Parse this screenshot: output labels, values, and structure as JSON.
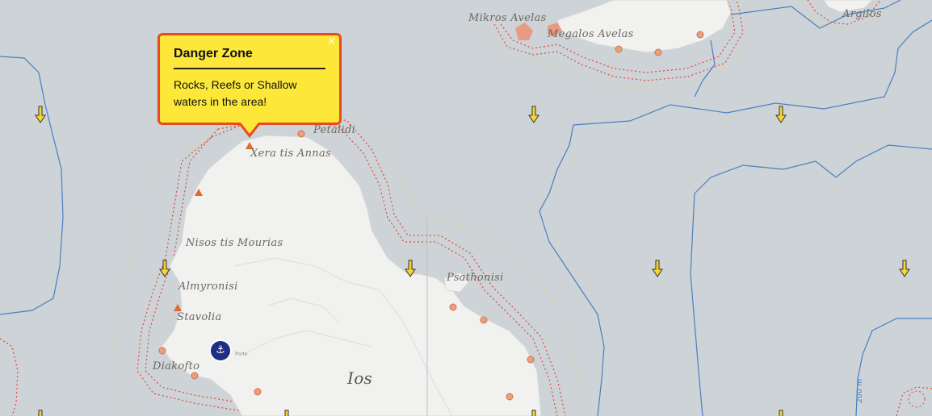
{
  "popup": {
    "title": "Danger Zone",
    "text": "Rocks, Reefs or Shallow waters in the area!",
    "close_label": "×"
  },
  "labels": {
    "mikros_avelas": "Mikros Avelas",
    "megalos_avelas": "Megalos Avelas",
    "argilos": "Argilos",
    "petalidi": "Petalidi",
    "xera_tis_annas": "Xera tis Annas",
    "nisos_tis_mourias": "Nisos tis Mourias",
    "almyronisi": "Almyronisi",
    "stavolia": "Stavolia",
    "psathonisi": "Psathonisi",
    "diakofto": "Diakofto",
    "ios": "Ios",
    "depth_200": "200 m",
    "marina_label": "Porto"
  },
  "icons": {
    "current_arrow": "down-arrow-icon",
    "marina": "marina-icon",
    "close": "close-icon",
    "danger": "danger-triangle-icon"
  },
  "colors": {
    "sea": "#cdd3d6",
    "land": "#f1f1f0",
    "hazard": "#e0493a",
    "depth_line": "#4a7fc4",
    "arrow": "#f5d630",
    "popup_bg": "#fde83a",
    "popup_border": "#ea4a1f",
    "marina": "#1c2f84"
  }
}
